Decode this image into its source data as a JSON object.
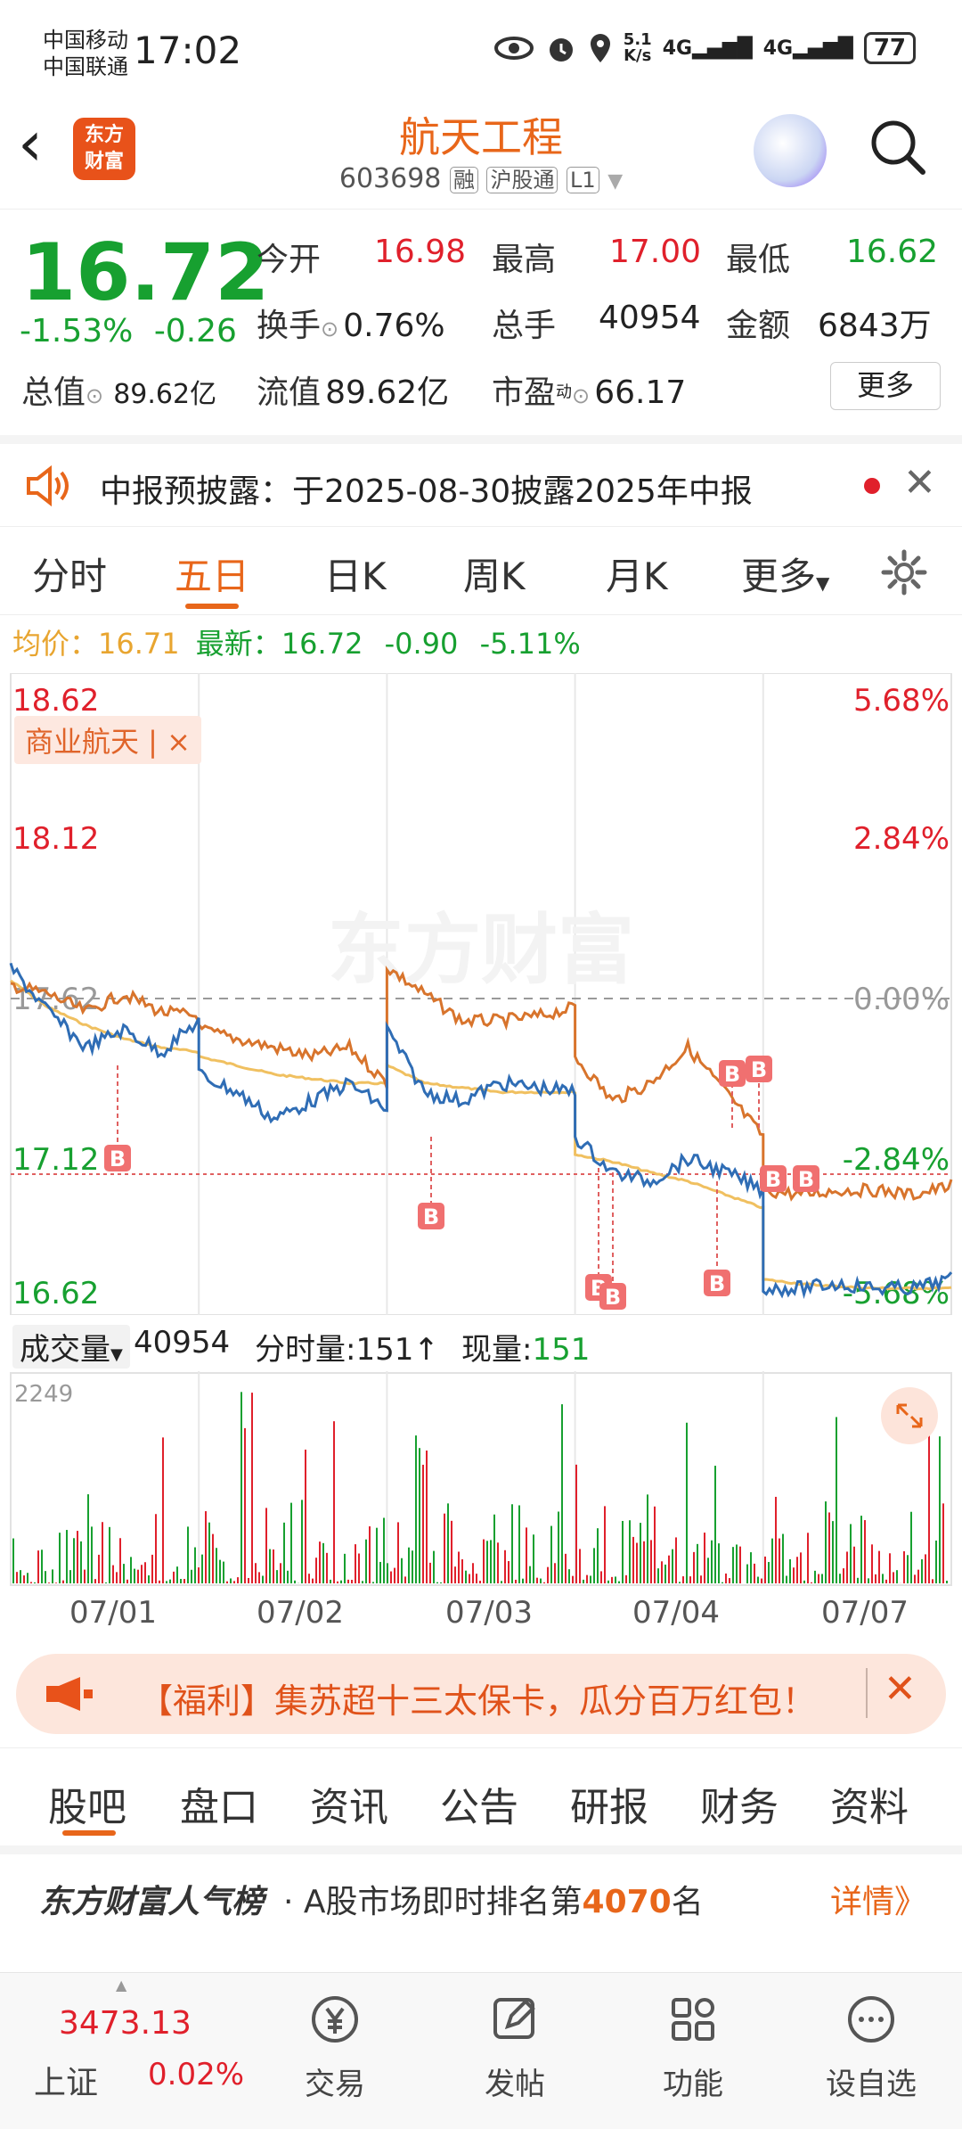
{
  "status_bar": {
    "carrier1": "中国移动",
    "carrier2": "中国联通",
    "time": "17:02",
    "net_speed_value": "5.1",
    "net_speed_unit": "K/s",
    "net1": "4G",
    "net2": "4G",
    "battery": "77"
  },
  "header": {
    "logo_line1": "东方",
    "logo_line2": "财富",
    "stock_name": "航天工程",
    "stock_code": "603698",
    "tag_margin": "融",
    "tag_connect": "沪股通",
    "tag_level": "L1"
  },
  "quote": {
    "price": "16.72",
    "change_pct": "-1.53%",
    "change_amt": "-0.26",
    "open_label": "今开",
    "open": "16.98",
    "high_label": "最高",
    "high": "17.00",
    "low_label": "最低",
    "low": "16.62",
    "turnover_label": "换手",
    "turnover": "0.76%",
    "volume_label": "总手",
    "volume": "40954",
    "amount_label": "金额",
    "amount": "6843万",
    "total_cap_label": "总值",
    "total_cap": "89.62亿",
    "float_cap_label": "流值",
    "float_cap": "89.62亿",
    "pe_label": "市盈",
    "pe_sup": "动",
    "pe": "66.17",
    "more_label": "更多"
  },
  "notice": {
    "text": "中报预披露：于2025-08-30披露2025年中报"
  },
  "chart_tabs": {
    "items": [
      "分时",
      "五日",
      "日K",
      "周K",
      "月K",
      "更多"
    ],
    "active": "五日"
  },
  "info_line": {
    "avg_label": "均价：",
    "avg": "16.71",
    "latest_label": "最新：",
    "latest": "16.72",
    "chg": "-0.90",
    "chg_pct": "-5.11%"
  },
  "chart_data": {
    "type": "line",
    "x": [
      "07/01",
      "07/02",
      "07/03",
      "07/04",
      "07/07"
    ],
    "y_left_ticks": [
      "18.62",
      "18.12",
      "17.62",
      "17.12",
      "16.62"
    ],
    "y_right_ticks": [
      "5.68%",
      "2.84%",
      "0.00%",
      "-2.84%",
      "-5.68%"
    ],
    "ylim": [
      16.62,
      18.62
    ],
    "concept_tag": "商业航天 | ×",
    "watermark": "东方财富",
    "series": [],
    "trade_marker": "B",
    "colors": {
      "price": "#2f6db5",
      "sector": "#d8742c",
      "avg": "#f0c060",
      "up": "#e0202b",
      "down": "#17a030"
    }
  },
  "volume_bar": {
    "selector_label": "成交量",
    "volume": "40954",
    "minute_label": "分时量:",
    "minute_value": "151↑",
    "current_label": "现量:",
    "current_value": "151",
    "max_label": "2249"
  },
  "promo": {
    "text": "【福利】集苏超十三太保卡，瓜分百万红包！"
  },
  "bottom_tabs": {
    "items": [
      "股吧",
      "盘口",
      "资讯",
      "公告",
      "研报",
      "财务",
      "资料"
    ],
    "active": "股吧"
  },
  "rank": {
    "brand": "东方财富人气榜",
    "text_pre": "· A股市场即时排名第",
    "rank_value": "4070",
    "text_post": "名",
    "detail": "详情》"
  },
  "navbar": {
    "index_value": "3473.13",
    "index_name": "上证",
    "index_pct": "0.02%",
    "items": [
      "交易",
      "发帖",
      "功能",
      "设自选"
    ]
  }
}
